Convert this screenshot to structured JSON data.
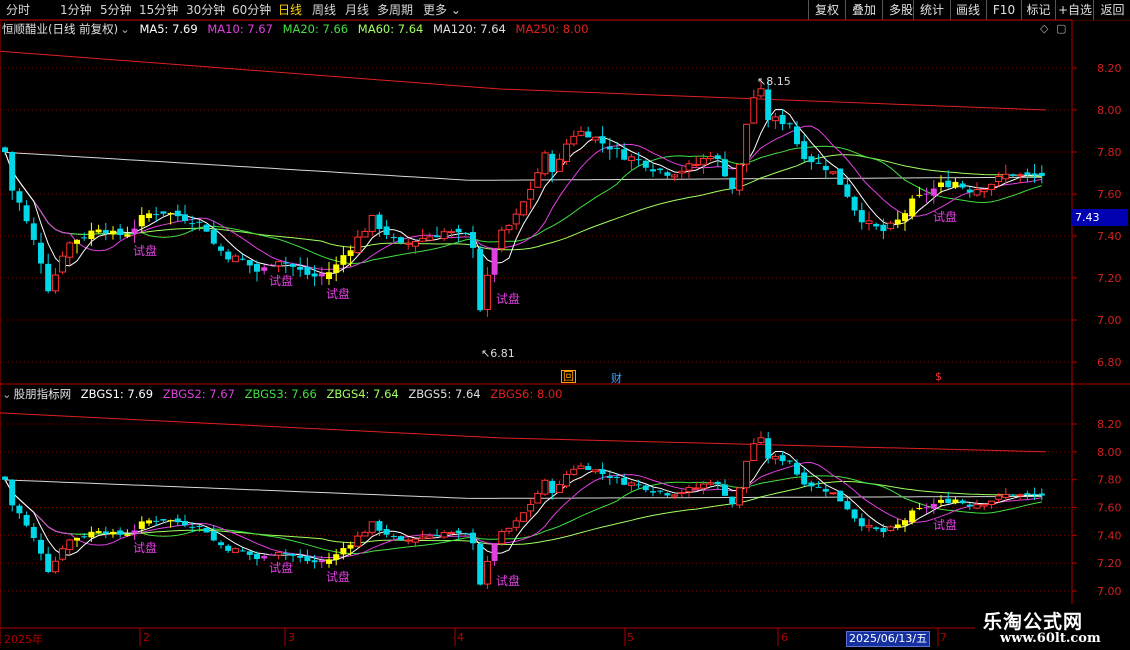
{
  "toolbar": {
    "periods": [
      "分时",
      "1分钟",
      "5分钟",
      "15分钟",
      "30分钟",
      "60分钟",
      "日线",
      "周线",
      "月线",
      "多周期",
      "更多"
    ],
    "active_period": "日线",
    "buttons": [
      "复权",
      "叠加",
      "多股",
      "统计",
      "画线",
      "F10",
      "标记",
      "+自选",
      "返回"
    ]
  },
  "main_panel": {
    "title": "恒顺醋业(日线 前复权)",
    "legend": [
      {
        "label": "MA5: 7.69",
        "color": "#ffffff"
      },
      {
        "label": "MA10: 7.67",
        "color": "#e040e0"
      },
      {
        "label": "MA20: 7.66",
        "color": "#40e040"
      },
      {
        "label": "MA60: 7.64",
        "color": "#a0ff60"
      },
      {
        "label": "MA120: 7.64",
        "color": "#e0e0e0"
      },
      {
        "label": "MA250: 8.00",
        "color": "#e02020"
      }
    ],
    "y_ticks": [
      "8.20",
      "8.00",
      "7.80",
      "7.60",
      "7.43",
      "7.40",
      "7.20",
      "7.00",
      "6.80"
    ],
    "current_price": "7.43",
    "high_label": "8.15",
    "low_label": "6.81",
    "signal_text": "试盘",
    "markers": {
      "box": "回",
      "finance": "财",
      "dollar": "$"
    }
  },
  "sub_panel": {
    "title": "股朋指标网",
    "legend": [
      {
        "label": "ZBGS1: 7.69",
        "color": "#ffffff"
      },
      {
        "label": "ZBGS2: 7.67",
        "color": "#e040e0"
      },
      {
        "label": "ZBGS3: 7.66",
        "color": "#40e040"
      },
      {
        "label": "ZBGS4: 7.64",
        "color": "#a0ff60"
      },
      {
        "label": "ZBGS5: 7.64",
        "color": "#e0e0e0"
      },
      {
        "label": "ZBGS6: 8.00",
        "color": "#e02020"
      }
    ],
    "y_ticks": [
      "8.20",
      "8.00",
      "7.80",
      "7.60",
      "7.40",
      "7.20",
      "7.00"
    ],
    "signal_text": "试盘"
  },
  "x_axis": {
    "labels": [
      "2025年",
      "2",
      "3",
      "4",
      "5",
      "6",
      "7"
    ],
    "cursor_date": "2025/06/13/五"
  },
  "watermark": {
    "line1": "乐淘公式网",
    "line2": "www.60lt.com"
  },
  "colors": {
    "up": "#ff3232",
    "down": "#00d8e8",
    "yellow": "#ffff00",
    "magenta": "#e040e0",
    "grid": "#7a0000",
    "axis": "#b00000"
  }
}
